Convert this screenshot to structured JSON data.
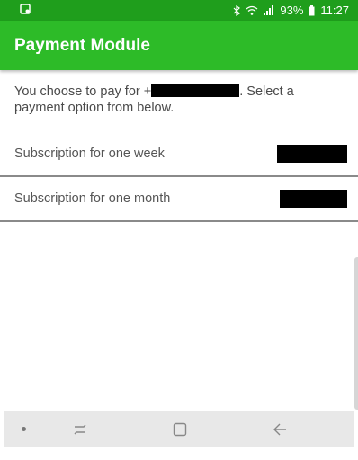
{
  "status_bar": {
    "left_icon": "notification-icon",
    "icons": [
      "bluetooth-icon",
      "wifi-icon",
      "signal-icon"
    ],
    "battery_percent": "93%",
    "battery_icon": "battery-icon",
    "time": "11:27"
  },
  "app_bar": {
    "title": "Payment Module"
  },
  "intro": {
    "text_before": "You choose to pay for +",
    "text_after": ". Select a payment option from below."
  },
  "options": [
    {
      "label": "Subscription for one week"
    },
    {
      "label": "Subscription for one month"
    }
  ],
  "nav_bar": {
    "icons": [
      "nav-dot-icon",
      "recents-icon",
      "home-icon",
      "back-icon"
    ]
  },
  "colors": {
    "status_bar": "#1f9e1c",
    "app_bar": "#2dbb28",
    "divider": "#8a8a8a"
  }
}
